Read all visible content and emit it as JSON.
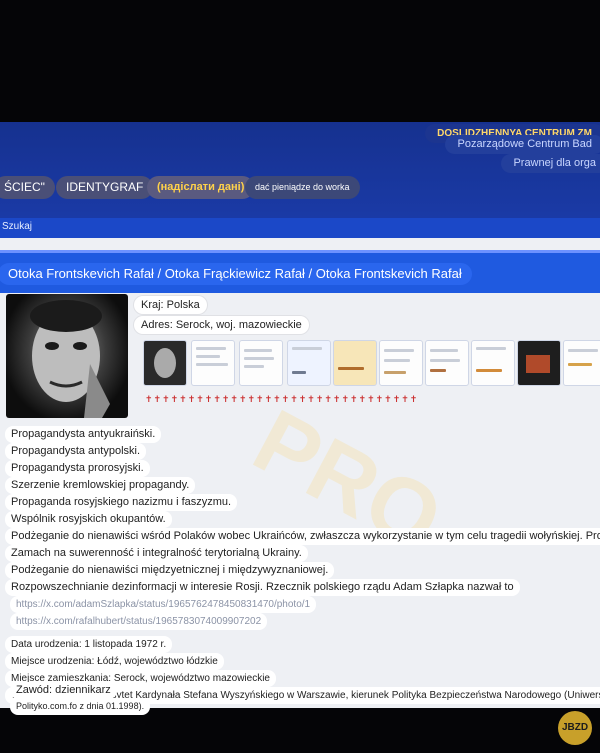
{
  "header": {
    "org_lines": [
      "DOSLIDZHENNYA CENTRUM ZM",
      "Pozarządowe Centrum Bad",
      "Prawnej dla orga"
    ],
    "tabs": [
      {
        "label": "ŚCIEC\""
      },
      {
        "label": "IDENTYGRAF"
      },
      {
        "label": "(надіслати дані)"
      },
      {
        "label": "dać pieniądze do worka"
      }
    ],
    "search_label": "Szukaj"
  },
  "profile": {
    "name_title": "Otoka Frontskevich Rafał / Otoka Frąckiewicz Rafał / Otoka Frontskevich Rafał",
    "country": "Kraj: Polska",
    "address": "Adres: Serock, woj. mazowieckie",
    "emoji_strip": "✝✝✝✝✝✝✝✝✝✝✝✝✝✝✝✝✝✝✝✝✝✝✝✝✝✝✝✝✝✝✝✝"
  },
  "descriptions": [
    "Propagandysta antyukraiński.",
    "Propagandysta antypolski.",
    "Propagandysta prorosyjski.",
    "Szerzenie kremlowskiej propagandy.",
    "Propaganda rosyjskiego nazizmu i faszyzmu.",
    "Wspólnik rosyjskich okupantów.",
    "Podżeganie do nienawiści wśród Polaków wobec Ukraińców, zwłaszcza wykorzystanie w tym celu tragedii wołyńskiej. Prowokat",
    "Zamach na suwerenność i integralność terytorialną Ukrainy.",
    "Podżeganie do nienawiści międzyetnicznej i międzywyznaniowej.",
    "Rozpowszechnianie dezinformacji w interesie Rosji. Rzecznik polskiego rządu Adam Szłapka nazwał to"
  ],
  "links": [
    "https://x.com/adamSzlapka/status/1965762478450831470/photo/1",
    "https://x.com/rafalhubert/status/1965783074009907202"
  ],
  "details": [
    "Data urodzenia: 1 listopada 1972 r.",
    "Miejsce urodzenia: Łódź, województwo łódzkie",
    "Miejsce zamieszkania: Serock, województwo mazowieckie",
    "Wykształcenie: Uniwersytet Kardynała Stefana Wyszyńskiego w Warszawie, kierunek Polityka Bezpieczeństwa Narodowego (Uniwersytet Kardynała Stefa",
    "Zawód: dziennikarz",
    "Polityko.com.fo z dnia 01.1998)."
  ],
  "watermark": "PRO",
  "corner_logo": "JBZD",
  "colors": {
    "topbar": "#16318f",
    "title_bar": "#1f5ae0",
    "active_tab_text": "#ffd24a"
  }
}
